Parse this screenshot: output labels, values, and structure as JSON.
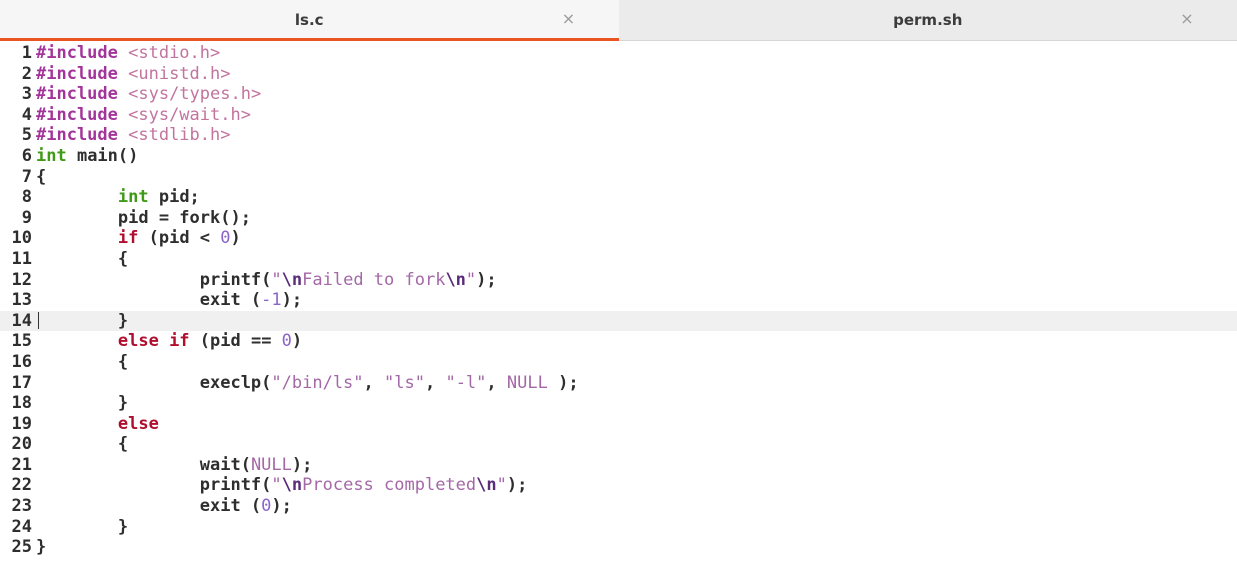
{
  "tabs": [
    {
      "label": "ls.c",
      "active": true,
      "close_icon": "×"
    },
    {
      "label": "perm.sh",
      "active": false,
      "close_icon": "×"
    }
  ],
  "editor": {
    "current_line": 14,
    "lines": [
      {
        "n": "1",
        "parts": [
          [
            "pp",
            "#include "
          ],
          [
            "inc",
            "<stdio.h>"
          ]
        ]
      },
      {
        "n": "2",
        "parts": [
          [
            "pp",
            "#include "
          ],
          [
            "inc",
            "<unistd.h>"
          ]
        ]
      },
      {
        "n": "3",
        "parts": [
          [
            "pp",
            "#include "
          ],
          [
            "inc",
            "<sys/types.h>"
          ]
        ]
      },
      {
        "n": "4",
        "parts": [
          [
            "pp",
            "#include "
          ],
          [
            "inc",
            "<sys/wait.h>"
          ]
        ]
      },
      {
        "n": "5",
        "parts": [
          [
            "pp",
            "#include "
          ],
          [
            "inc",
            "<stdlib.h>"
          ]
        ]
      },
      {
        "n": "6",
        "parts": [
          [
            "ty",
            "int"
          ],
          [
            "fn",
            " main()"
          ]
        ]
      },
      {
        "n": "7",
        "parts": [
          [
            "fn",
            "{"
          ]
        ]
      },
      {
        "n": "8",
        "parts": [
          [
            "fn",
            "        "
          ],
          [
            "ty",
            "int"
          ],
          [
            "fn",
            " pid;"
          ]
        ]
      },
      {
        "n": "9",
        "parts": [
          [
            "fn",
            "        pid = fork();"
          ]
        ]
      },
      {
        "n": "10",
        "parts": [
          [
            "fn",
            "        "
          ],
          [
            "kw",
            "if"
          ],
          [
            "fn",
            " (pid < "
          ],
          [
            "num",
            "0"
          ],
          [
            "fn",
            ")"
          ]
        ]
      },
      {
        "n": "11",
        "parts": [
          [
            "fn",
            "        {"
          ]
        ]
      },
      {
        "n": "12",
        "parts": [
          [
            "fn",
            "                printf("
          ],
          [
            "str",
            "\""
          ],
          [
            "esc",
            "\\n"
          ],
          [
            "str",
            "Failed to fork"
          ],
          [
            "esc",
            "\\n"
          ],
          [
            "str",
            "\""
          ],
          [
            "fn",
            ");"
          ]
        ]
      },
      {
        "n": "13",
        "parts": [
          [
            "fn",
            "                exit ("
          ],
          [
            "num",
            "-1"
          ],
          [
            "fn",
            ");"
          ]
        ]
      },
      {
        "n": "14",
        "parts": [
          [
            "fn",
            "        }"
          ]
        ]
      },
      {
        "n": "15",
        "parts": [
          [
            "fn",
            "        "
          ],
          [
            "kw",
            "else if"
          ],
          [
            "fn",
            " (pid == "
          ],
          [
            "num",
            "0"
          ],
          [
            "fn",
            ")"
          ]
        ]
      },
      {
        "n": "16",
        "parts": [
          [
            "fn",
            "        {"
          ]
        ]
      },
      {
        "n": "17",
        "parts": [
          [
            "fn",
            "                execlp("
          ],
          [
            "str",
            "\"/bin/ls\""
          ],
          [
            "fn",
            ", "
          ],
          [
            "str",
            "\"ls\""
          ],
          [
            "fn",
            ", "
          ],
          [
            "str",
            "\"-l\""
          ],
          [
            "fn",
            ", "
          ],
          [
            "null",
            "NULL"
          ],
          [
            "fn",
            " );"
          ]
        ]
      },
      {
        "n": "18",
        "parts": [
          [
            "fn",
            "        }"
          ]
        ]
      },
      {
        "n": "19",
        "parts": [
          [
            "fn",
            "        "
          ],
          [
            "kw",
            "else"
          ]
        ]
      },
      {
        "n": "20",
        "parts": [
          [
            "fn",
            "        {"
          ]
        ]
      },
      {
        "n": "21",
        "parts": [
          [
            "fn",
            "                wait("
          ],
          [
            "null",
            "NULL"
          ],
          [
            "fn",
            ");"
          ]
        ]
      },
      {
        "n": "22",
        "parts": [
          [
            "fn",
            "                printf("
          ],
          [
            "str",
            "\""
          ],
          [
            "esc",
            "\\n"
          ],
          [
            "str",
            "Process completed"
          ],
          [
            "esc",
            "\\n"
          ],
          [
            "str",
            "\""
          ],
          [
            "fn",
            ");"
          ]
        ]
      },
      {
        "n": "23",
        "parts": [
          [
            "fn",
            "                exit ("
          ],
          [
            "num",
            "0"
          ],
          [
            "fn",
            ");"
          ]
        ]
      },
      {
        "n": "24",
        "parts": [
          [
            "fn",
            "        }"
          ]
        ]
      },
      {
        "n": "25",
        "parts": [
          [
            "fn",
            "}"
          ]
        ]
      }
    ]
  }
}
